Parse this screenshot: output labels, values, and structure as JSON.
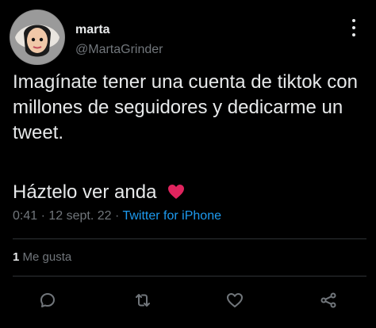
{
  "tweet": {
    "name": "marta",
    "handle": "@MartaGrinder",
    "text_1": "Imagínate tener una cuenta de tiktok con millones de seguidores y dedicarme un tweet.",
    "text_2": "Háztelo ver anda",
    "time": "0:41",
    "date": "12 sept. 22",
    "source": "Twitter for iPhone",
    "likes_count": "1",
    "likes_label": "Me gusta"
  },
  "icons": {
    "more": "more-icon",
    "reply": "reply-icon",
    "retweet": "retweet-icon",
    "like": "heart-outline-icon",
    "share": "share-icon",
    "emoji_heart": "red-heart-emoji"
  },
  "colors": {
    "background": "#000000",
    "text": "#e7e9ea",
    "muted": "#71767b",
    "link": "#1d9bf0",
    "heart": "#e0245e"
  }
}
